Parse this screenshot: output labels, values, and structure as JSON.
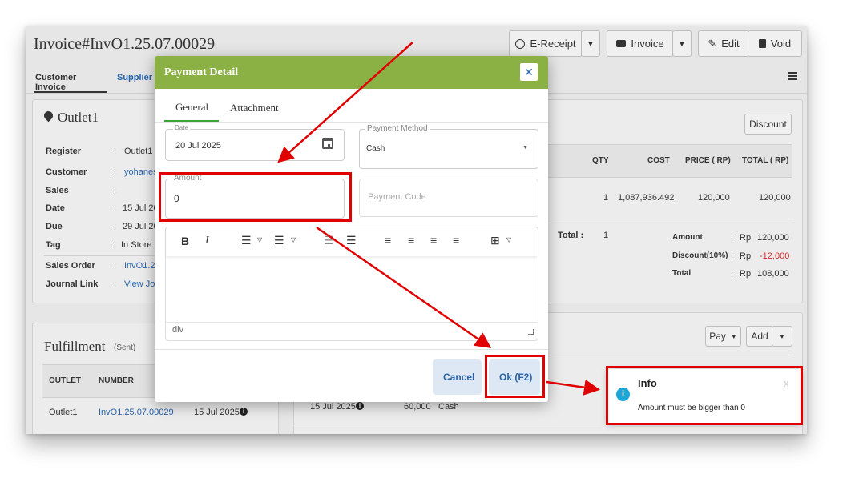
{
  "page": {
    "title": "Invoice#InvO1.25.07.00029"
  },
  "toolbar": {
    "ereceipt": "E-Receipt",
    "invoice": "Invoice",
    "edit": "Edit",
    "void": "Void"
  },
  "tabs": {
    "customer_invoice": "Customer Invoice",
    "supplier": "Supplier E"
  },
  "outlet": {
    "name": "Outlet1",
    "fields": [
      {
        "label": "Register",
        "value": "Outlet1"
      },
      {
        "label": "Customer",
        "value": "yohanes"
      },
      {
        "label": "Sales",
        "value": ""
      },
      {
        "label": "Date",
        "value": "15 Jul 20"
      },
      {
        "label": "Due",
        "value": "29 Jul 20"
      },
      {
        "label": "Tag",
        "value": "In Store"
      },
      {
        "label": "Sales Order",
        "value": "InvO1.25"
      },
      {
        "label": "Journal Link",
        "value": "View Jou"
      }
    ]
  },
  "items": {
    "discount_btn": "Discount",
    "headers": {
      "qty": "QTY",
      "cost": "COST",
      "price": "PRICE ( RP)",
      "total": "TOTAL ( RP)"
    },
    "row": {
      "qty": "1",
      "cost": "1,087,936.492",
      "price": "120,000",
      "total": "120,000"
    },
    "total_label": "Total :",
    "total_qty": "1",
    "summary": {
      "amount_label": "Amount",
      "amount_cur": "Rp",
      "amount_value": "120,000",
      "discount_label": "Discount(10%)",
      "discount_cur": "Rp",
      "discount_value": "-12,000",
      "total_label": "Total",
      "total_cur": "Rp",
      "total_value": "108,000",
      "sep": ":"
    }
  },
  "payments": {
    "pay_btn": "Pay",
    "add_btn": "Add",
    "row": {
      "date": "15 Jul 2025",
      "amount": "60,000",
      "method": "Cash"
    }
  },
  "fulfillment": {
    "title": "Fulfillment",
    "status": "(Sent)",
    "headers": {
      "outlet": "OUTLET",
      "number": "NUMBER"
    },
    "row": {
      "outlet": "Outlet1",
      "number": "InvO1.25.07.00029",
      "date": "15 Jul 2025"
    }
  },
  "modal": {
    "title": "Payment Detail",
    "tabs": {
      "general": "General",
      "attachment": "Attachment"
    },
    "date": {
      "label": "Date",
      "value": "20 Jul 2025"
    },
    "payment_method": {
      "label": "Payment Method",
      "value": "Cash"
    },
    "amount": {
      "label": "Amount",
      "value": "0"
    },
    "payment_code": {
      "placeholder": "Payment Code"
    },
    "editor": {
      "status": "div"
    },
    "cancel": "Cancel",
    "ok": "Ok (F2)"
  },
  "toast": {
    "title": "Info",
    "message": "Amount must be bigger than 0",
    "close": "x"
  },
  "colors": {
    "modal_header": "#8bb043",
    "annotation": "#e00000",
    "discount_red": "#d62b2b",
    "info_icon": "#1aa7d8",
    "tab_active": "#3aa33a"
  }
}
